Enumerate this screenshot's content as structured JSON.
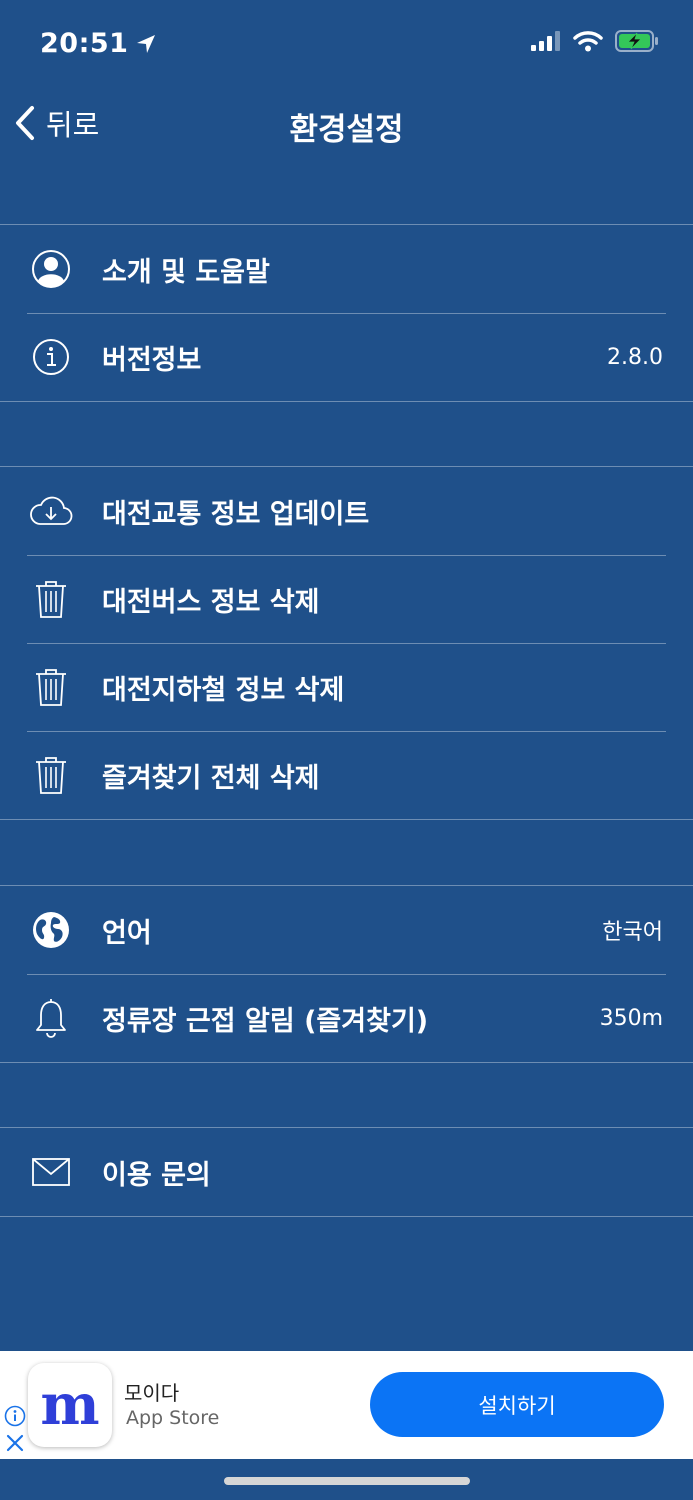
{
  "status_bar": {
    "time": "20:51"
  },
  "nav": {
    "back_label": "뒤로",
    "title": "환경설정"
  },
  "groups": [
    {
      "items": [
        {
          "label": "소개 및 도움말",
          "icon": "user-circle-icon"
        },
        {
          "label": "버전정보",
          "value": "2.8.0",
          "icon": "info-icon"
        }
      ]
    },
    {
      "items": [
        {
          "label": "대전교통 정보 업데이트",
          "icon": "cloud-download-icon"
        },
        {
          "label": "대전버스 정보 삭제",
          "icon": "trash-icon"
        },
        {
          "label": "대전지하철 정보 삭제",
          "icon": "trash-icon"
        },
        {
          "label": "즐겨찾기 전체 삭제",
          "icon": "trash-icon"
        }
      ]
    },
    {
      "items": [
        {
          "label": "언어",
          "value": "한국어",
          "icon": "globe-icon"
        },
        {
          "label": "정류장 근접 알림 (즐겨찾기)",
          "value": "350m",
          "icon": "bell-icon"
        }
      ]
    },
    {
      "items": [
        {
          "label": "이용 문의",
          "icon": "mail-icon"
        }
      ]
    }
  ],
  "ad": {
    "app_name": "모이다",
    "store": "App Store",
    "install_label": "설치하기",
    "logo_text": "m"
  },
  "colors": {
    "background": "#1f508a",
    "ad_button": "#0b74f5"
  }
}
